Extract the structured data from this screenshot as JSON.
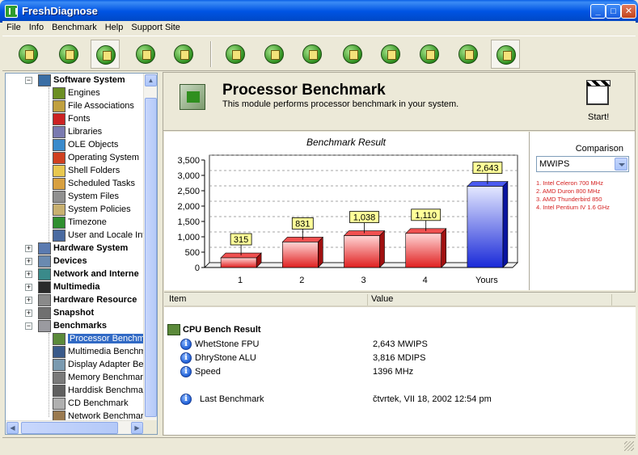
{
  "window": {
    "title": "FreshDiagnose"
  },
  "menu": [
    "File",
    "Info",
    "Benchmark",
    "Help",
    "Support Site"
  ],
  "tree": {
    "items": [
      {
        "label": "Software System",
        "level": 0,
        "bold": true,
        "expander": "−",
        "color": "#3a6ea5"
      },
      {
        "label": "Engines",
        "level": 1,
        "color": "#6b8e23"
      },
      {
        "label": "File Associations",
        "level": 1,
        "color": "#c0a040"
      },
      {
        "label": "Fonts",
        "level": 1,
        "color": "#cc2222"
      },
      {
        "label": "Libraries",
        "level": 1,
        "color": "#7a7ab0"
      },
      {
        "label": "OLE Objects",
        "level": 1,
        "color": "#3a8acb"
      },
      {
        "label": "Operating System",
        "level": 1,
        "color": "#d04020"
      },
      {
        "label": "Shell Folders",
        "level": 1,
        "color": "#e8c850"
      },
      {
        "label": "Scheduled Tasks",
        "level": 1,
        "color": "#d8a040"
      },
      {
        "label": "System Files",
        "level": 1,
        "color": "#909090"
      },
      {
        "label": "System Policies",
        "level": 1,
        "color": "#c8b070"
      },
      {
        "label": "Timezone",
        "level": 1,
        "color": "#2f8f2f"
      },
      {
        "label": "User and Locale Inf",
        "level": 1,
        "color": "#4a6aa0"
      },
      {
        "label": "Hardware System",
        "level": 0,
        "bold": true,
        "expander": "+",
        "color": "#5a7ab0"
      },
      {
        "label": "Devices",
        "level": 0,
        "bold": true,
        "expander": "+",
        "color": "#6a8ab0"
      },
      {
        "label": "Network and Interne",
        "level": 0,
        "bold": true,
        "expander": "+",
        "color": "#3a8a8a"
      },
      {
        "label": "Multimedia",
        "level": 0,
        "bold": true,
        "expander": "+",
        "color": "#2a2a2a"
      },
      {
        "label": "Hardware Resource",
        "level": 0,
        "bold": true,
        "expander": "+",
        "color": "#8a8a8a"
      },
      {
        "label": "Snapshot",
        "level": 0,
        "bold": true,
        "expander": "+",
        "color": "#707070"
      },
      {
        "label": "Benchmarks",
        "level": 0,
        "bold": true,
        "expander": "−",
        "color": "#9a9aa0"
      },
      {
        "label": "Processor Benchma",
        "level": 1,
        "selected": true,
        "color": "#5b8a3a"
      },
      {
        "label": "Multimedia Benchm",
        "level": 1,
        "color": "#3a5a8a"
      },
      {
        "label": "Display Adapter Ber",
        "level": 1,
        "color": "#7a9ab0"
      },
      {
        "label": "Memory Benchmark",
        "level": 1,
        "color": "#7a7a7a"
      },
      {
        "label": "Harddisk Benchmar",
        "level": 1,
        "color": "#606060"
      },
      {
        "label": "CD Benchmark",
        "level": 1,
        "color": "#b0b0b0"
      },
      {
        "label": "Network Benchmar",
        "level": 1,
        "color": "#9a7a50"
      }
    ]
  },
  "header": {
    "title": "Processor Benchmark",
    "description": "This module performs processor benchmark in your system.",
    "start_label": "Start!"
  },
  "comparison": {
    "label": "Comparison",
    "selected": "MWIPS",
    "items": [
      "1. Intel Celeron 700 MHz",
      "2. AMD Duron 800 MHz",
      "3. AMD Thunderbird 850",
      "4. Intel Pentium IV 1.6 GHz"
    ]
  },
  "chart_data": {
    "type": "bar",
    "title": "Benchmark Result",
    "categories": [
      "1",
      "2",
      "3",
      "4",
      "Yours"
    ],
    "values": [
      315,
      831,
      1038,
      1110,
      2643
    ],
    "value_labels": [
      "315",
      "831",
      "1,038",
      "1,110",
      "2,643"
    ],
    "ylim": [
      0,
      3500
    ],
    "yticks": [
      0,
      500,
      1000,
      1500,
      2000,
      2500,
      3000,
      3500
    ],
    "ytick_labels": [
      "0",
      "500",
      "1,000",
      "1,500",
      "2,000",
      "2,500",
      "3,000",
      "3,500"
    ],
    "grid": true,
    "colors": {
      "reference": "#e02020",
      "yours": "#1a2ad8",
      "label_bg": "#ffff99"
    }
  },
  "list": {
    "columns": [
      "Item",
      "Value"
    ],
    "group": "CPU Bench Result",
    "rows": [
      {
        "item": "WhetStone FPU",
        "value": "2,643 MWIPS"
      },
      {
        "item": "DhryStone ALU",
        "value": "3,816 MDIPS"
      },
      {
        "item": "Speed",
        "value": "1396 MHz"
      }
    ],
    "last": {
      "item": "Last Benchmark",
      "value": "čtvrtek, VII 18, 2002 12:54 pm"
    }
  }
}
